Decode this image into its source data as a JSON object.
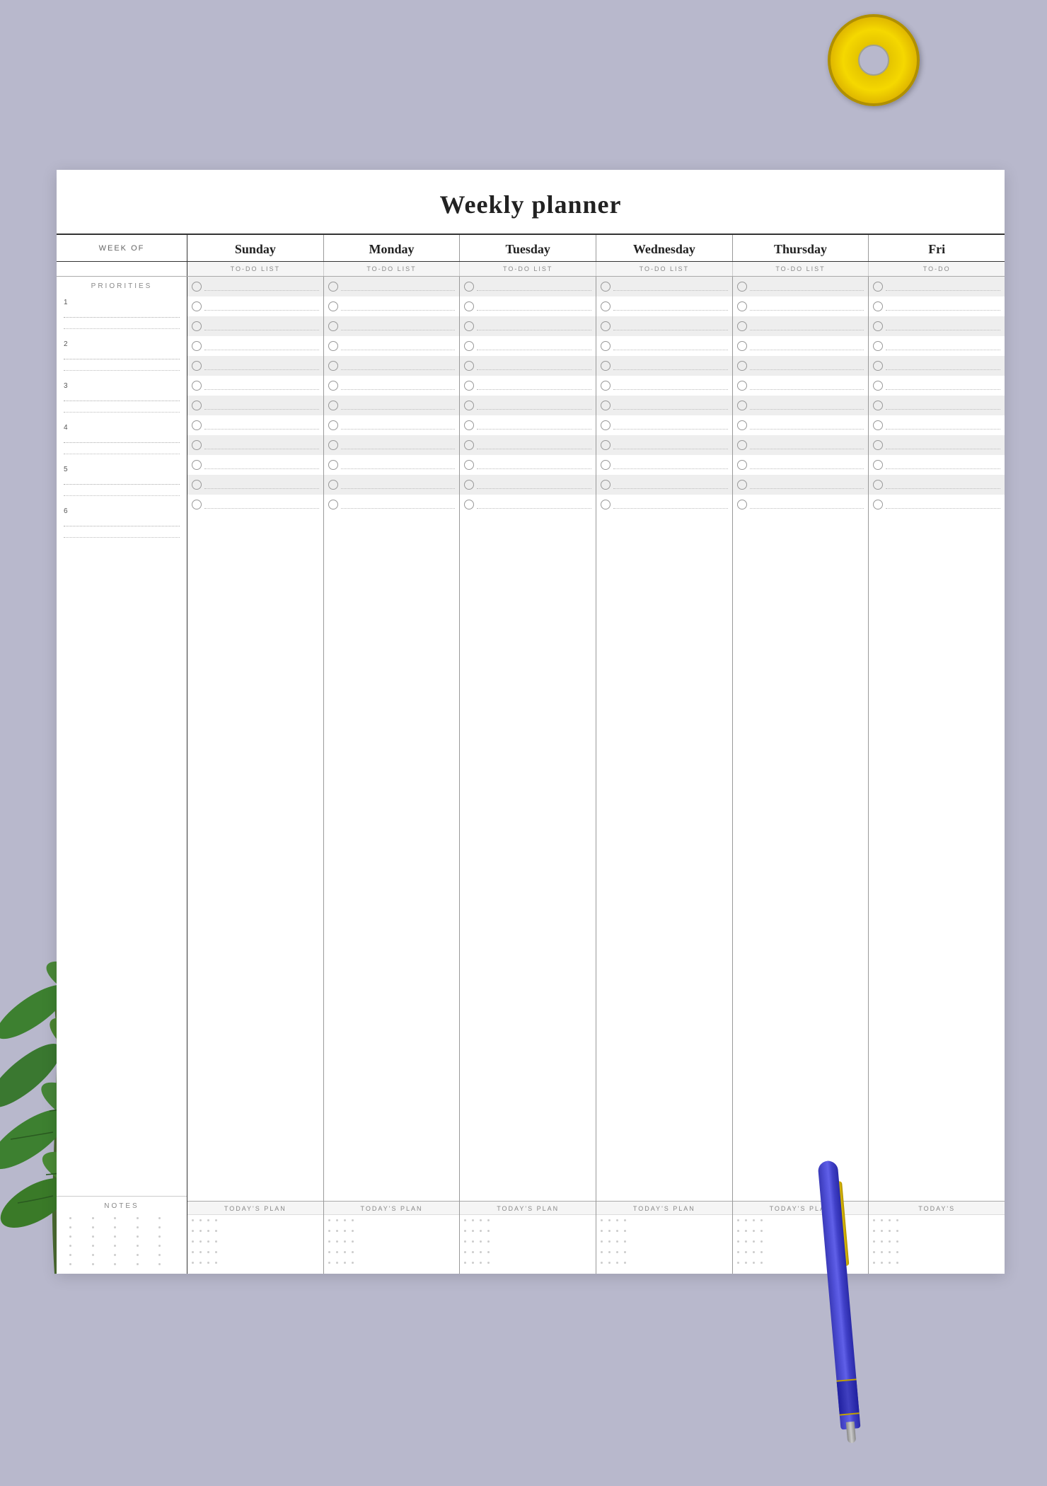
{
  "background_color": "#b8b8cc",
  "title": "Weekly planner",
  "header": {
    "week_of_label": "WEEK OF",
    "days": [
      "Sunday",
      "Monday",
      "Tuesday",
      "Wednesday",
      "Thursday",
      "Fri"
    ],
    "todo_label": "TO-DO LIST",
    "todays_plan_label": "TODAY'S PLAN"
  },
  "sidebar": {
    "priorities_label": "PRIORITIES",
    "notes_label": "NOTES",
    "priority_numbers": [
      "1",
      "2",
      "3",
      "4",
      "5",
      "6"
    ]
  },
  "todo_rows_per_day": 12,
  "plan_dot_rows": 5
}
